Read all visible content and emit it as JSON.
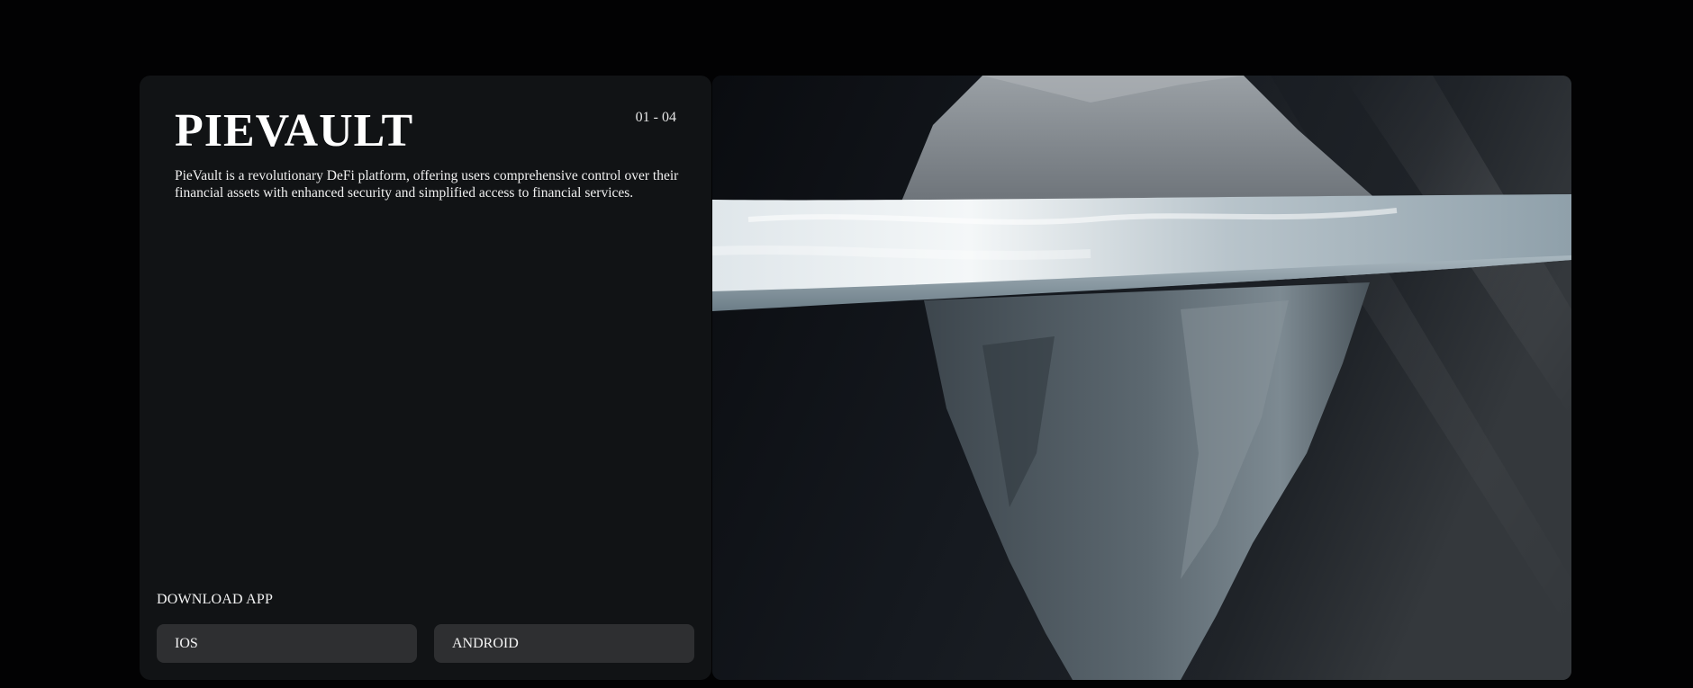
{
  "brand": {
    "title": "PIEVAULT",
    "slide_counter": "01 - 04",
    "description": "PieVault is a revolutionary DeFi platform, offering users comprehensive control over their financial assets with enhanced security and simplified access to financial services."
  },
  "download": {
    "label": "DOWNLOAD APP",
    "buttons": [
      {
        "label": "IOS"
      },
      {
        "label": "ANDROID"
      }
    ]
  },
  "hero": {
    "image": "iceberg-underwater-illustration"
  },
  "colors": {
    "page_bg": "#020203",
    "card_bg": "#111315",
    "button_bg": "#2e2f31",
    "text": "#f2f2f2"
  }
}
